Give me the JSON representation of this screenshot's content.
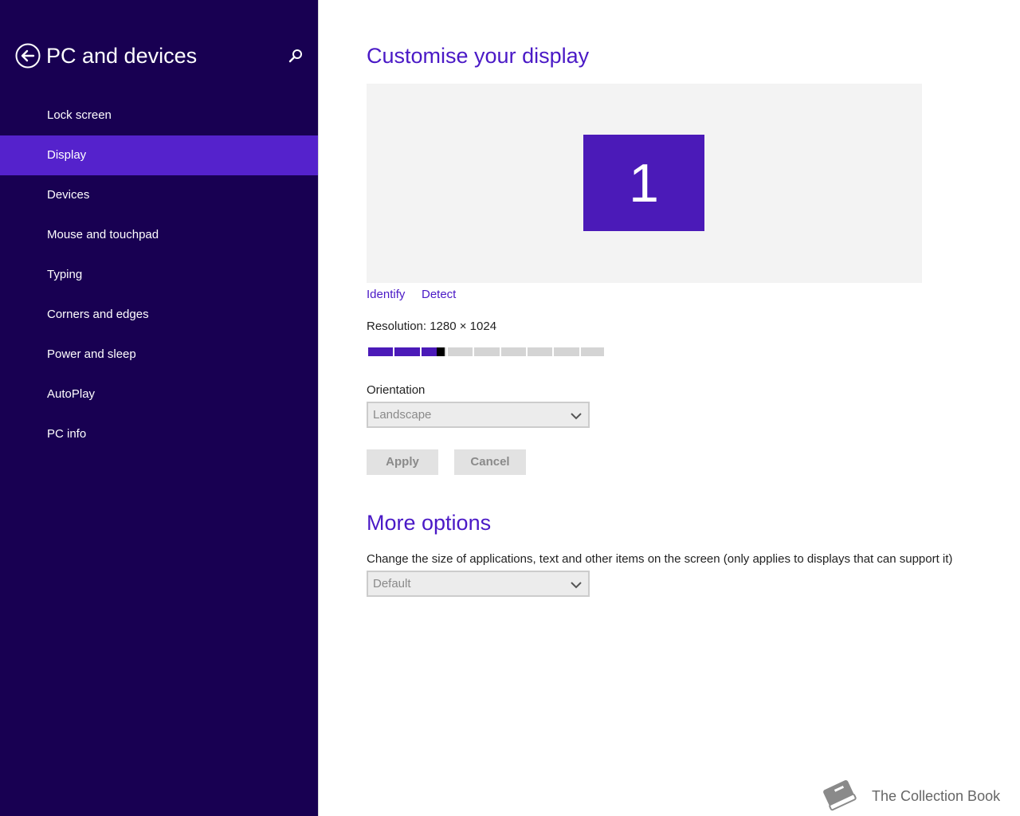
{
  "sidebar": {
    "title": "PC and devices",
    "back_icon": "back-arrow-icon",
    "search_icon": "search-icon",
    "items": [
      {
        "label": "Lock screen",
        "active": false
      },
      {
        "label": "Display",
        "active": true
      },
      {
        "label": "Devices",
        "active": false
      },
      {
        "label": "Mouse and touchpad",
        "active": false
      },
      {
        "label": "Typing",
        "active": false
      },
      {
        "label": "Corners and edges",
        "active": false
      },
      {
        "label": "Power and sleep",
        "active": false
      },
      {
        "label": "AutoPlay",
        "active": false
      },
      {
        "label": "PC info",
        "active": false
      }
    ]
  },
  "main": {
    "heading": "Customise your display",
    "monitor_number": "1",
    "identify_label": "Identify",
    "detect_label": "Detect",
    "resolution_label": "Resolution: 1280 × 1024",
    "resolution_slider": {
      "position_fraction": 0.31,
      "steps": 9
    },
    "orientation_label": "Orientation",
    "orientation_value": "Landscape",
    "apply_label": "Apply",
    "cancel_label": "Cancel",
    "more_options_heading": "More options",
    "size_description": "Change the size of applications, text and other items on the screen (only applies to displays that can support it)",
    "size_value": "Default"
  },
  "watermark": {
    "text": "The Collection Book",
    "icon": "book-icon"
  },
  "colors": {
    "sidebar_bg": "#180052",
    "sidebar_active": "#5522cc",
    "accent": "#4a19c6",
    "tile": "#4b1ab8"
  }
}
